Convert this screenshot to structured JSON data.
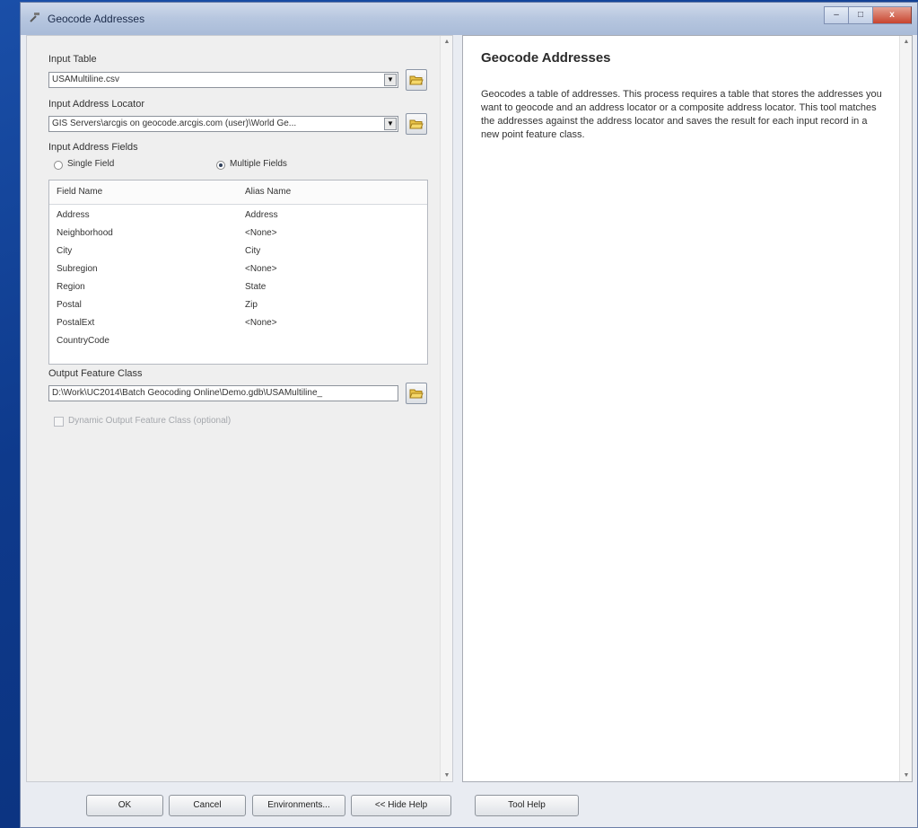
{
  "window": {
    "title": "Geocode Addresses"
  },
  "caption_buttons": {
    "minimize": "–",
    "maximize": "□",
    "close": "x"
  },
  "form": {
    "input_table": {
      "label": "Input Table",
      "value": "USAMultiline.csv"
    },
    "address_locator": {
      "label": "Input Address Locator",
      "value": "GIS Servers\\arcgis on geocode.arcgis.com (user)\\World Ge..."
    },
    "address_fields": {
      "label": "Input Address Fields",
      "options": [
        {
          "label": "Single Field",
          "selected": false
        },
        {
          "label": "Multiple Fields",
          "selected": true
        }
      ]
    },
    "field_table": {
      "headers": [
        "Field Name",
        "Alias Name"
      ],
      "rows": [
        {
          "field": "Address",
          "alias": "Address"
        },
        {
          "field": "Neighborhood",
          "alias": "<None>"
        },
        {
          "field": "City",
          "alias": "City"
        },
        {
          "field": "Subregion",
          "alias": "<None>"
        },
        {
          "field": "Region",
          "alias": "State"
        },
        {
          "field": "Postal",
          "alias": "Zip"
        },
        {
          "field": "PostalExt",
          "alias": "<None>"
        },
        {
          "field": "CountryCode",
          "alias": ""
        }
      ]
    },
    "output_feature_class": {
      "label": "Output Feature Class",
      "value": "D:\\Work\\UC2014\\Batch Geocoding Online\\Demo.gdb\\USAMultiline_"
    },
    "dynamic_output": {
      "label": "Dynamic Output Feature Class (optional)",
      "checked": false
    }
  },
  "buttons": {
    "ok": "OK",
    "cancel": "Cancel",
    "environments": "Environments...",
    "hide_help": "<< Hide Help",
    "tool_help": "Tool Help"
  },
  "help": {
    "title": "Geocode Addresses",
    "body": "Geocodes a table of addresses. This process requires a table that stores the addresses you want to geocode and an address locator or a composite address locator. This tool matches the addresses against the address locator and saves the result for each input record in a new point feature class."
  },
  "colors": {
    "titlebar": "#b6c6df",
    "close_button": "#c8442e",
    "desktop": "#0e3a8c"
  }
}
